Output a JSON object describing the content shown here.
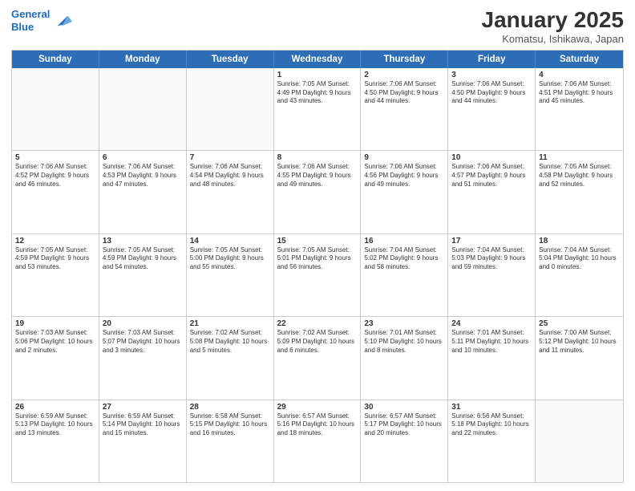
{
  "header": {
    "logo_line1": "General",
    "logo_line2": "Blue",
    "title": "January 2025",
    "subtitle": "Komatsu, Ishikawa, Japan"
  },
  "weekdays": [
    "Sunday",
    "Monday",
    "Tuesday",
    "Wednesday",
    "Thursday",
    "Friday",
    "Saturday"
  ],
  "weeks": [
    [
      {
        "day": "",
        "info": ""
      },
      {
        "day": "",
        "info": ""
      },
      {
        "day": "",
        "info": ""
      },
      {
        "day": "1",
        "info": "Sunrise: 7:05 AM\nSunset: 4:49 PM\nDaylight: 9 hours\nand 43 minutes."
      },
      {
        "day": "2",
        "info": "Sunrise: 7:06 AM\nSunset: 4:50 PM\nDaylight: 9 hours\nand 44 minutes."
      },
      {
        "day": "3",
        "info": "Sunrise: 7:06 AM\nSunset: 4:50 PM\nDaylight: 9 hours\nand 44 minutes."
      },
      {
        "day": "4",
        "info": "Sunrise: 7:06 AM\nSunset: 4:51 PM\nDaylight: 9 hours\nand 45 minutes."
      }
    ],
    [
      {
        "day": "5",
        "info": "Sunrise: 7:06 AM\nSunset: 4:52 PM\nDaylight: 9 hours\nand 46 minutes."
      },
      {
        "day": "6",
        "info": "Sunrise: 7:06 AM\nSunset: 4:53 PM\nDaylight: 9 hours\nand 47 minutes."
      },
      {
        "day": "7",
        "info": "Sunrise: 7:06 AM\nSunset: 4:54 PM\nDaylight: 9 hours\nand 48 minutes."
      },
      {
        "day": "8",
        "info": "Sunrise: 7:06 AM\nSunset: 4:55 PM\nDaylight: 9 hours\nand 49 minutes."
      },
      {
        "day": "9",
        "info": "Sunrise: 7:06 AM\nSunset: 4:56 PM\nDaylight: 9 hours\nand 49 minutes."
      },
      {
        "day": "10",
        "info": "Sunrise: 7:06 AM\nSunset: 4:57 PM\nDaylight: 9 hours\nand 51 minutes."
      },
      {
        "day": "11",
        "info": "Sunrise: 7:05 AM\nSunset: 4:58 PM\nDaylight: 9 hours\nand 52 minutes."
      }
    ],
    [
      {
        "day": "12",
        "info": "Sunrise: 7:05 AM\nSunset: 4:59 PM\nDaylight: 9 hours\nand 53 minutes."
      },
      {
        "day": "13",
        "info": "Sunrise: 7:05 AM\nSunset: 4:59 PM\nDaylight: 9 hours\nand 54 minutes."
      },
      {
        "day": "14",
        "info": "Sunrise: 7:05 AM\nSunset: 5:00 PM\nDaylight: 9 hours\nand 55 minutes."
      },
      {
        "day": "15",
        "info": "Sunrise: 7:05 AM\nSunset: 5:01 PM\nDaylight: 9 hours\nand 56 minutes."
      },
      {
        "day": "16",
        "info": "Sunrise: 7:04 AM\nSunset: 5:02 PM\nDaylight: 9 hours\nand 58 minutes."
      },
      {
        "day": "17",
        "info": "Sunrise: 7:04 AM\nSunset: 5:03 PM\nDaylight: 9 hours\nand 59 minutes."
      },
      {
        "day": "18",
        "info": "Sunrise: 7:04 AM\nSunset: 5:04 PM\nDaylight: 10 hours\nand 0 minutes."
      }
    ],
    [
      {
        "day": "19",
        "info": "Sunrise: 7:03 AM\nSunset: 5:06 PM\nDaylight: 10 hours\nand 2 minutes."
      },
      {
        "day": "20",
        "info": "Sunrise: 7:03 AM\nSunset: 5:07 PM\nDaylight: 10 hours\nand 3 minutes."
      },
      {
        "day": "21",
        "info": "Sunrise: 7:02 AM\nSunset: 5:08 PM\nDaylight: 10 hours\nand 5 minutes."
      },
      {
        "day": "22",
        "info": "Sunrise: 7:02 AM\nSunset: 5:09 PM\nDaylight: 10 hours\nand 6 minutes."
      },
      {
        "day": "23",
        "info": "Sunrise: 7:01 AM\nSunset: 5:10 PM\nDaylight: 10 hours\nand 8 minutes."
      },
      {
        "day": "24",
        "info": "Sunrise: 7:01 AM\nSunset: 5:11 PM\nDaylight: 10 hours\nand 10 minutes."
      },
      {
        "day": "25",
        "info": "Sunrise: 7:00 AM\nSunset: 5:12 PM\nDaylight: 10 hours\nand 11 minutes."
      }
    ],
    [
      {
        "day": "26",
        "info": "Sunrise: 6:59 AM\nSunset: 5:13 PM\nDaylight: 10 hours\nand 13 minutes."
      },
      {
        "day": "27",
        "info": "Sunrise: 6:59 AM\nSunset: 5:14 PM\nDaylight: 10 hours\nand 15 minutes."
      },
      {
        "day": "28",
        "info": "Sunrise: 6:58 AM\nSunset: 5:15 PM\nDaylight: 10 hours\nand 16 minutes."
      },
      {
        "day": "29",
        "info": "Sunrise: 6:57 AM\nSunset: 5:16 PM\nDaylight: 10 hours\nand 18 minutes."
      },
      {
        "day": "30",
        "info": "Sunrise: 6:57 AM\nSunset: 5:17 PM\nDaylight: 10 hours\nand 20 minutes."
      },
      {
        "day": "31",
        "info": "Sunrise: 6:56 AM\nSunset: 5:18 PM\nDaylight: 10 hours\nand 22 minutes."
      },
      {
        "day": "",
        "info": ""
      }
    ]
  ]
}
